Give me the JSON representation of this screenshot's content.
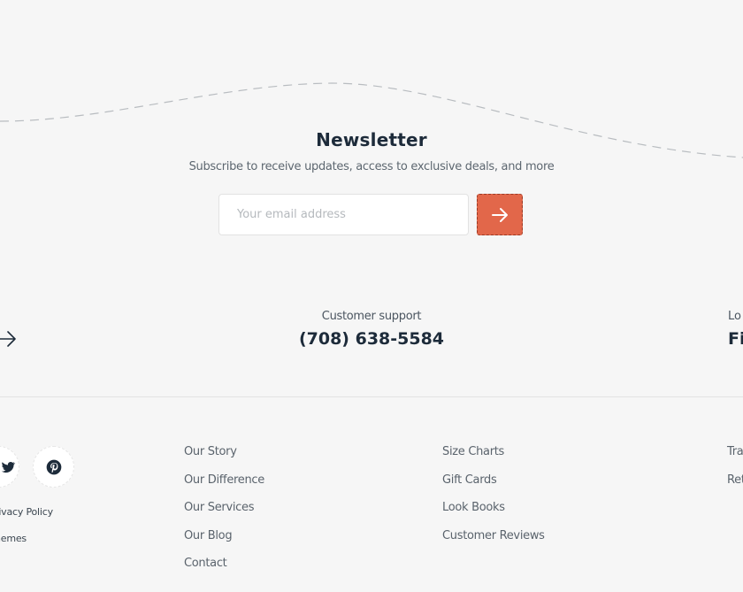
{
  "newsletter": {
    "title": "Newsletter",
    "subtitle": "Subscribe to receive updates, access to exclusive deals, and more",
    "email_placeholder": "Your email address",
    "email_value": "",
    "submit_icon": "arrow-right-icon"
  },
  "contact": {
    "left_icon": "arrow-right-icon",
    "support_label": "Customer support",
    "support_phone": "(708) 638-5584",
    "location_label": "Lo",
    "location_value": "Fi"
  },
  "social": [
    {
      "name": "twitter",
      "icon": "twitter-icon"
    },
    {
      "name": "pinterest",
      "icon": "pinterest-icon"
    }
  ],
  "legal": {
    "privacy": "rivacy Policy",
    "themes": "hemes"
  },
  "footer": {
    "col1": [
      "Our Story",
      "Our Difference",
      "Our Services",
      "Our Blog",
      "Contact"
    ],
    "col2": [
      "Size Charts",
      "Gift Cards",
      "Look Books",
      "Customer Reviews"
    ],
    "col3": [
      "Tra",
      "Ret"
    ]
  },
  "colors": {
    "background": "#f6f6f6",
    "accent": "#e2674a",
    "heading": "#1d2b3a",
    "muted": "#5a636c"
  }
}
